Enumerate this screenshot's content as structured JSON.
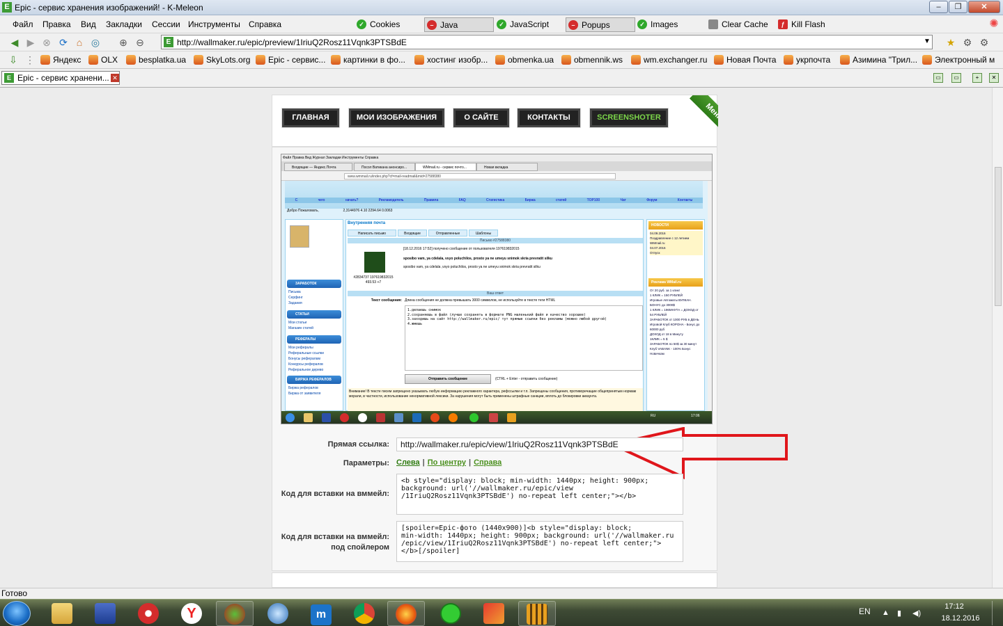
{
  "window": {
    "title": "Epic - сервис хранения изображений! - K-Meleon",
    "icon_letter": "E",
    "min_label": "–",
    "max_label": "❐",
    "close_label": "✕"
  },
  "menubar": {
    "items": [
      {
        "label": "Файл"
      },
      {
        "label": "Правка"
      },
      {
        "label": "Вид"
      },
      {
        "label": "Закладки"
      },
      {
        "label": "Сессии"
      },
      {
        "label": "Инструменты"
      },
      {
        "label": "Справка"
      }
    ],
    "toggles": [
      {
        "label": "Cookies",
        "state": "on"
      },
      {
        "label": "Java",
        "state": "off"
      },
      {
        "label": "JavaScript",
        "state": "on"
      },
      {
        "label": "Popups",
        "state": "off"
      },
      {
        "label": "Images",
        "state": "on"
      },
      {
        "label": "Clear Cache",
        "state": "action"
      },
      {
        "label": "Kill Flash",
        "state": "action"
      }
    ]
  },
  "navbar": {
    "url": "http://wallmaker.ru/epic/preview/1IriuQ2Rosz11Vqnk3PTSBdE"
  },
  "bookmarks": [
    {
      "label": "Яндекс"
    },
    {
      "label": "OLX"
    },
    {
      "label": "besplatka.ua"
    },
    {
      "label": "SkyLots.org"
    },
    {
      "label": "Epic - сервис..."
    },
    {
      "label": "картинки в фо..."
    },
    {
      "label": "хостинг изобр..."
    },
    {
      "label": "obmenka.ua"
    },
    {
      "label": "obmennik.ws"
    },
    {
      "label": "wm.exchanger.ru"
    },
    {
      "label": "Новая Почта"
    },
    {
      "label": "укрпочта"
    },
    {
      "label": "Азимина \"Трил..."
    },
    {
      "label": "Электронный м"
    }
  ],
  "tabs": [
    {
      "label": "Epic - сервис хранени..."
    }
  ],
  "site_nav": {
    "items": [
      {
        "label": "ГЛАВНАЯ"
      },
      {
        "label": "МОИ ИЗОБРАЖЕНИЯ"
      },
      {
        "label": "О САЙТЕ"
      },
      {
        "label": "КОНТАКТЫ"
      },
      {
        "label": "SCREENSHOTER"
      }
    ],
    "menu_ribbon": "Меню"
  },
  "preview": {
    "menu_line": "Файл  Правка  Вид  Журнал  Закладки  Инструменты  Справка",
    "tabs": [
      "Входящие — Яндекс.Почта",
      "Посол Ватикана анонсиро...",
      "WMmail.ru - сервис почто...",
      "Новая вкладка"
    ],
    "url": "www.wmmail.ru/index.php?cf=mail-readmail&mid=27588380",
    "top_menu": "С чего начать? Рекламодатель Правила FAQ Статистика Биржа статей TOP100 Чат Форум Контакты",
    "welcome": "Добро Пожаловать,",
    "stats": "2,3144976   4.10   2294.64   0.0063",
    "center_title": "Внутренняя почта",
    "center_tabs": [
      "Написать письмо",
      "Входящие",
      "Отправленные",
      "Шаблоны"
    ],
    "letter_title": "Письмо #27588380",
    "msg_header": "[18.12.2016 17:52] получено сообщение от пользователя 197619832015",
    "msg_subject": "sposibo vam, ya cdelala, vsyo poluchilos, prosto ya ne umeyu snimok skria prevratit silku",
    "msg_body": "sposibo vam, ya cdelala ,vsyo poluchilos, prosto ya ne umeyu snimok skria prevratit silku",
    "user_id": "#2834737 197619832015",
    "user_rating": "493.53   +7",
    "reply_title": "Ваш ответ",
    "text_label": "Текст сообщения:",
    "text_hint": "Длина сообщения не должна превышать 3000 символов, не используйте в тексте теги HTML",
    "textarea": "1.делаешь снимок\n2.сохраняешь в файл (лучше сохранять в формате PNG маленький файл и качество хорошее)\n3.заходишь на сайт http://wallmaker.ru/epic/ тут прямые ссылки без рекламы (можно любой другой)\n4.жмешь",
    "send_button": "Отправить сообщение",
    "send_hint": "(CTRL + Enter - отправить сообщение)",
    "warning": "Внимание! В тексте писем запрещено указывать любую информацию рекламного характера, рефссылки и т.п. Запрещены сообщения, противоречащие общепринятым нормам морали, в частности, использование ненормативной лексики. За нарушения могут быть применены штрафные санкции, вплоть до блокировки аккаунта.",
    "left_sections": [
      {
        "title": "ЗАРАБОТОК",
        "items": [
          "Письма",
          "Серфинг",
          "Задания"
        ]
      },
      {
        "title": "СТАТЬИ",
        "items": [
          "Мои статьи",
          "Магазин статей"
        ]
      },
      {
        "title": "РЕФЕРАЛЫ",
        "items": [
          "Мои рефералы",
          "Реферальные ссылки",
          "Бонусы рефералам",
          "Конкурсы рефералов",
          "Реферальное дерево"
        ]
      },
      {
        "title": "БИРЖА РЕФЕРАЛОВ",
        "items": [
          "Биржа рефералов",
          "Биржа от заявителя"
        ]
      }
    ],
    "right_news_title": "НОВОСТИ",
    "right_news": [
      "04.09.2016",
      "Поздравление с 12 летием WMmail.ru",
      "04.07.2016",
      "Отпуск"
    ],
    "right_ads_title": "Реклама WMail.ru",
    "right_ads": [
      "От 20 руб. за 1 клик!",
      "1 КЛИК = 150 РУБЛЕЙ",
      "Игровые Автоматы ВУЛКАН. БОНУС до 3000$",
      "1 КЛИК = 196МНУТА = ДОХОД от 54 РУБЛЕЙ",
      "ЗАРАБОТОК от 1000 РУБ в ДЕНЬ",
      "Игровой Клуб КОРОНА - Бонус до 60000 руб",
      "ДОХОД от 18 в Минуту",
      "1КЛИК = 5 $",
      "ЗАРАБОТОК по 50$ за 30 минут",
      "Клуб VABANK - 100% Бонус Новичкам"
    ],
    "tray_lang": "RU",
    "tray_time": "17:06"
  },
  "form": {
    "direct_link_label": "Прямая ссылка:",
    "direct_link_value": "http://wallmaker.ru/epic/view/1IriuQ2Rosz11Vqnk3PTSBdE",
    "params_label": "Параметры:",
    "params": [
      {
        "label": "Слева"
      },
      {
        "label": "По центру"
      },
      {
        "label": "Справа"
      }
    ],
    "params_sep": "|",
    "email_code_label": "Код для вставки на вммейл:",
    "email_code_value": "<b style=\"display: block; min-width: 1440px; height: 900px;\nbackground: url('//wallmaker.ru/epic/view\n/1IriuQ2Rosz11Vqnk3PTSBdE') no-repeat left center;\"></b>",
    "spoiler_code_label_1": "Код для вставки на вммейл:",
    "spoiler_code_label_2": "под спойлером",
    "spoiler_code_value": "[spoiler=Epic-фото (1440x900)]<b style=\"display: block;\nmin-width: 1440px; height: 900px; background: url('//wallmaker.ru\n/epic/view/1IriuQ2Rosz11Vqnk3PTSBdE') no-repeat left center;\">\n</b>[/spoiler]"
  },
  "status": {
    "text": "Готово"
  },
  "taskbar": {
    "lang": "EN",
    "time": "17:12",
    "date": "18.12.2016"
  },
  "colors": {
    "site_green": "#4a8f1d",
    "nav_dark": "#222222",
    "arrow_red": "#e0161b"
  }
}
